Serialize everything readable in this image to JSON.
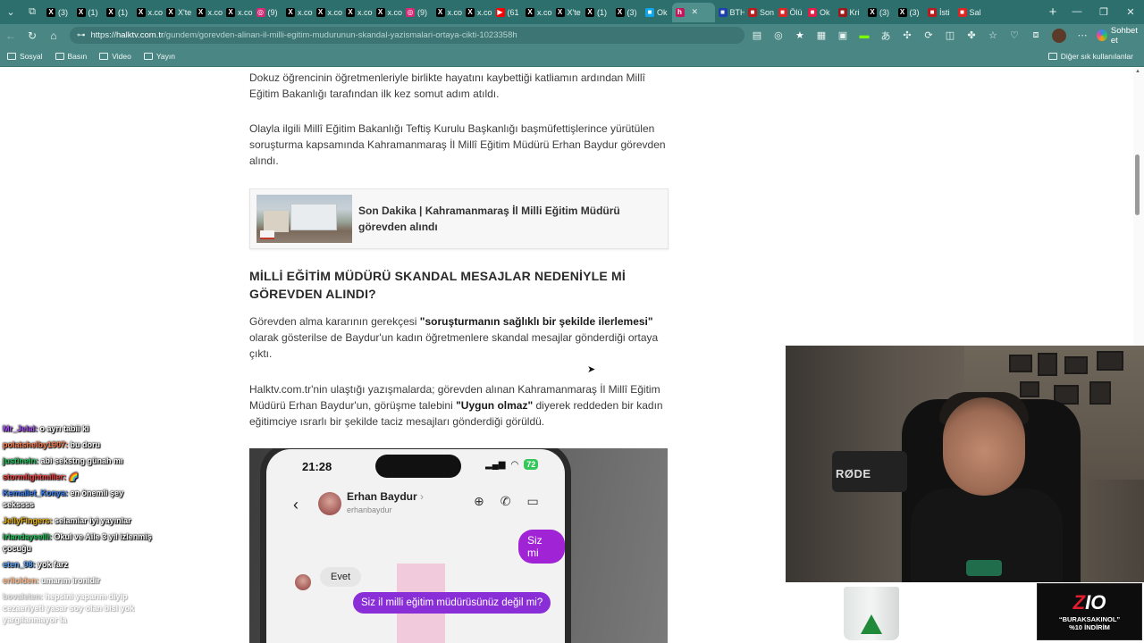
{
  "browser": {
    "tabs": [
      {
        "icon": "x-icon",
        "label": "(3)",
        "color": "#000000"
      },
      {
        "icon": "x-icon",
        "label": "(1)",
        "color": "#000000"
      },
      {
        "icon": "x-icon",
        "label": "(1)",
        "color": "#000000"
      },
      {
        "icon": "x-icon",
        "label": "x.co",
        "color": "#000000"
      },
      {
        "icon": "x-icon",
        "label": "X'te",
        "color": "#000000"
      },
      {
        "icon": "x-icon",
        "label": "x.co",
        "color": "#000000"
      },
      {
        "icon": "x-icon",
        "label": "x.co",
        "color": "#000000"
      },
      {
        "icon": "instagram-icon",
        "label": "(9)",
        "color": "#d62976"
      },
      {
        "icon": "x-icon",
        "label": "x.co",
        "color": "#000000"
      },
      {
        "icon": "x-icon",
        "label": "x.co",
        "color": "#000000"
      },
      {
        "icon": "x-icon",
        "label": "x.co",
        "color": "#000000"
      },
      {
        "icon": "x-icon",
        "label": "x.co",
        "color": "#000000"
      },
      {
        "icon": "instagram-icon",
        "label": "(9)",
        "color": "#d62976"
      },
      {
        "icon": "x-icon",
        "label": "x.co",
        "color": "#000000"
      },
      {
        "icon": "x-icon",
        "label": "x.co",
        "color": "#000000"
      },
      {
        "icon": "youtube-icon",
        "label": "(61",
        "color": "#ff0000"
      },
      {
        "icon": "x-icon",
        "label": "x.co",
        "color": "#000000"
      },
      {
        "icon": "x-icon",
        "label": "X'te",
        "color": "#000000"
      },
      {
        "icon": "x-icon",
        "label": "(1)",
        "color": "#000000"
      },
      {
        "icon": "x-icon",
        "label": "(3)",
        "color": "#000000"
      },
      {
        "icon": "site-icon",
        "label": "Ok",
        "color": "#0ea5e9"
      }
    ],
    "active_tab": {
      "icon": "halktv-icon",
      "label": "",
      "color": "#c2185b"
    },
    "tabs_after": [
      {
        "icon": "site-icon",
        "label": "BTH",
        "color": "#1e40af"
      },
      {
        "icon": "site-icon",
        "label": "Son",
        "color": "#b91c1c"
      },
      {
        "icon": "site-icon",
        "label": "Ölü",
        "color": "#dc2626"
      },
      {
        "icon": "site-icon",
        "label": "Ok",
        "color": "#e11d48"
      },
      {
        "icon": "site-icon",
        "label": "Kri",
        "color": "#991b1b"
      },
      {
        "icon": "x-icon",
        "label": "(3)",
        "color": "#000000"
      },
      {
        "icon": "x-icon",
        "label": "(3)",
        "color": "#000000"
      },
      {
        "icon": "site-icon",
        "label": "İsti",
        "color": "#b91c1c"
      },
      {
        "icon": "site-icon",
        "label": "Sal",
        "color": "#dc2626"
      }
    ],
    "url": {
      "scheme": "https://",
      "domain": "halktv.com.tr",
      "path": "/gundem/gorevden-alinan-il-milli-egitim-mudurunun-skandal-yazismalari-ortaya-cikti-1023358h"
    },
    "chat_button": "Sohbet et",
    "bookmarks": [
      "Sosyal",
      "Basın",
      "Video",
      "Yayın"
    ],
    "other_bookmarks": "Diğer sık kullanılanlar"
  },
  "article": {
    "p1": "Dokuz öğrencinin öğretmenleriyle birlikte hayatını kaybettiği katliamın ardından Millî Eğitim Bakanlığı tarafından ilk kez somut adım atıldı.",
    "p2": "Olayla ilgili Millî Eğitim Bakanlığı Teftiş Kurulu Başkanlığı başmüfettişlerince yürütülen soruşturma kapsamında Kahramanmaraş İl Millî Eğitim Müdürü Erhan Baydur görevden alındı.",
    "related_title": "Son Dakika | Kahramanmaraş İl Milli Eğitim Müdürü görevden alındı",
    "heading": "MİLLİ EĞİTİM MÜDÜRÜ SKANDAL MESAJLAR NEDENİYLE Mİ GÖREVDEN ALINDI?",
    "p3_pre": "Görevden alma kararının gerekçesi ",
    "p3_bold": "\"soruşturmanın sağlıklı bir şekilde ilerlemesi\"",
    "p3_post": " olarak gösterilse de Baydur'un kadın öğretmenlere skandal mesajlar gönderdiği ortaya çıktı.",
    "p4_pre": "Halktv.com.tr'nin ulaştığı yazışmalarda; görevden alınan Kahramanmaraş İl Millî Eğitim Müdürü Erhan Baydur'un, görüşme talebini ",
    "p4_bold": "\"Uygun olmaz\"",
    "p4_post": " diyerek reddeden bir kadın eğitimciye ısrarlı bir şekilde taciz mesajları gönderdiği görüldü."
  },
  "phone": {
    "time": "21:28",
    "battery": "72",
    "contact_name": "Erhan Baydur",
    "contact_chevron": "›",
    "contact_handle": "erhanbaydur",
    "msg_out_1": "Siz mi",
    "msg_in_1": "Evet",
    "msg_out_2": "Siz il milli eğitim müdürüsünüz değil mi?"
  },
  "chat": [
    {
      "user": "Mr_Jelal:",
      "text": "o ayrı tabii ki",
      "color": "#a855f7"
    },
    {
      "user": "polatshelby1907:",
      "text": "bu doru",
      "color": "#ff7f50"
    },
    {
      "user": "justinein:",
      "text": "abi sekstng günah mı",
      "color": "#22c55e"
    },
    {
      "user": "stormlightmiller:",
      "text": "🌈",
      "color": "#ef4444"
    },
    {
      "user": "Kemallet_Konya:",
      "text": "en önemli şey sekssss",
      "color": "#3b82f6"
    },
    {
      "user": "JellyFingers:",
      "text": "selamlar iyi yayınlar",
      "color": "#eab308"
    },
    {
      "user": "irlandayeelli:",
      "text": "Okul ve Aile 3 yıl izlenmiş çocuğu",
      "color": "#22c55e"
    },
    {
      "user": "eten_98:",
      "text": "yok farz",
      "color": "#60a5fa"
    },
    {
      "user": "erliolden:",
      "text": "umarım ironidir",
      "color": "#f97316"
    },
    {
      "user": "bovaleten:",
      "text": "hepsini yaparım diyip cezaeriyeti yasar soy olan bisi yok yargılanmayor la",
      "color": "#a3a3a3"
    }
  ],
  "webcam": {
    "mic_brand": "RØDE"
  },
  "sponsor": {
    "logo_z": "Z",
    "logo_rest": "IO",
    "code": "“BURAKSAKINOL”",
    "discount": "%10 İNDİRİM"
  },
  "colors": {
    "browser_chrome": "#2d6f6c",
    "address_bar": "#4a8784",
    "message_purple": "#a024d6"
  }
}
